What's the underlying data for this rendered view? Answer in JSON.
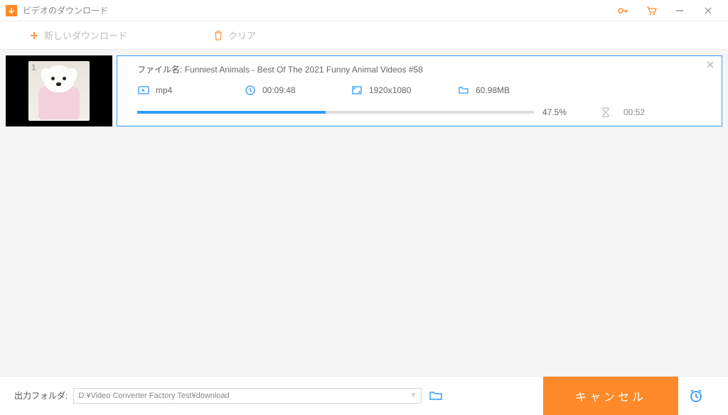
{
  "titlebar": {
    "title": "ビデオのダウンロード"
  },
  "toolbar": {
    "new_download": "新しいダウンロード",
    "clear": "クリア"
  },
  "item": {
    "index": "1",
    "filename_label": "ファイル名:",
    "filename": "Funniest Animals - Best Of The 2021 Funny Animal Videos #58",
    "format": "mp4",
    "duration": "00:09:48",
    "resolution": "1920x1080",
    "size": "60.98MB",
    "progress_pct": 47.5,
    "progress_label": "47.5%",
    "eta": "00:52"
  },
  "bottom": {
    "output_label": "出力フォルダ:",
    "output_path": "D:¥Video Converter Factory Test¥download",
    "cancel": "キャンセル"
  },
  "colors": {
    "accent_orange": "#ff8a2a",
    "accent_blue": "#2f9bff"
  }
}
